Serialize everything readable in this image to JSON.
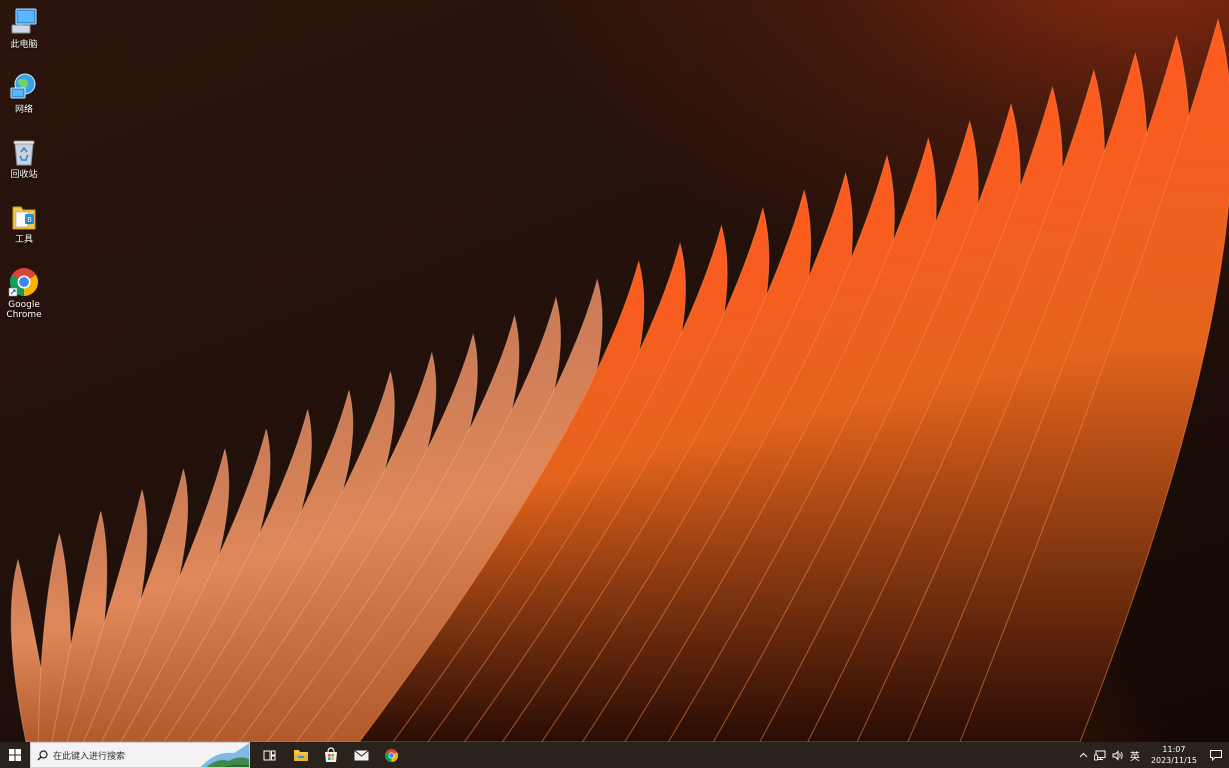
{
  "desktop": {
    "icons": [
      {
        "label": "此电脑",
        "icon": "this-pc-icon"
      },
      {
        "label": "网络",
        "icon": "network-icon"
      },
      {
        "label": "回收站",
        "icon": "recycle-bin-icon"
      },
      {
        "label": "工具",
        "icon": "tools-folder-icon"
      },
      {
        "label": "Google Chrome",
        "icon": "chrome-icon"
      }
    ],
    "wallpaper_colors": {
      "dark": "#1c0d08",
      "accent": "#e86a1a",
      "highlight": "#f5a15c"
    }
  },
  "taskbar": {
    "search": {
      "placeholder": "在此键入进行搜索"
    },
    "pinned": [
      {
        "name": "task-view",
        "icon": "task-view-icon"
      },
      {
        "name": "file-explorer",
        "icon": "file-explorer-icon"
      },
      {
        "name": "microsoft-store",
        "icon": "store-icon"
      },
      {
        "name": "mail",
        "icon": "mail-icon"
      },
      {
        "name": "chrome",
        "icon": "chrome-icon"
      }
    ],
    "tray": {
      "ime": "英",
      "time": "11:07",
      "date": "2023/11/15"
    },
    "colors": {
      "background": "#2a221d"
    }
  }
}
